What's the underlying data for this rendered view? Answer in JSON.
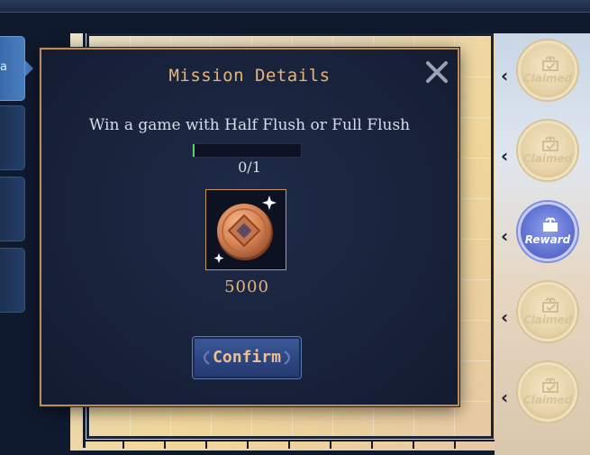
{
  "side_tabs": [
    {
      "label": "a",
      "active": true
    },
    {
      "label": "",
      "active": false
    },
    {
      "label": "",
      "active": false
    },
    {
      "label": "",
      "active": false
    }
  ],
  "modal": {
    "title": "Mission Details",
    "mission": "Win a game with Half Flush or Full Flush",
    "progress": {
      "current": 0,
      "total": 1,
      "text": "0/1",
      "fraction": 0.0
    },
    "reward": {
      "icon": "copper-coin-icon",
      "amount": "5000"
    },
    "confirm_label": "Confirm",
    "close_icon": "close-icon"
  },
  "milestones": [
    {
      "label": "Claimed",
      "state": "claimed"
    },
    {
      "label": "Claimed",
      "state": "claimed"
    },
    {
      "label": "Reward",
      "state": "reward"
    },
    {
      "label": "Claimed",
      "state": "claimed"
    },
    {
      "label": "Claimed",
      "state": "claimed"
    }
  ],
  "colors": {
    "modal_bg": "#18223a",
    "modal_border": "#b98c5e",
    "title": "#e7b47a",
    "progress_fill": "#5fd06a",
    "confirm_bg": "#2d4682",
    "reward_badge": "#6272d2"
  }
}
